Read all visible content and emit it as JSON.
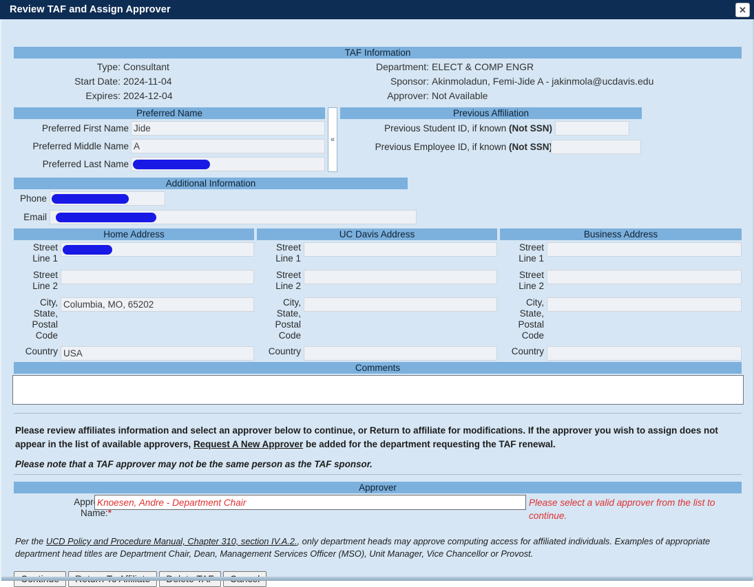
{
  "window": {
    "title": "Review TAF and Assign Approver",
    "close_label": "✕"
  },
  "taf_information": {
    "heading": "TAF Information",
    "rows": [
      {
        "label": "Type:",
        "value": "Consultant",
        "label2": "Department:",
        "value2": "ELECT & COMP ENGR"
      },
      {
        "label": "Start Date:",
        "value": "2024-11-04",
        "label2": "Sponsor:",
        "value2": "Akinmoladun, Femi-Jide A - jakinmola@ucdavis.edu"
      },
      {
        "label": "Expires:",
        "value": "2024-12-04",
        "label2": "Approver:",
        "value2": "Not Available"
      }
    ]
  },
  "preferred_name": {
    "heading": "Preferred Name",
    "fields": [
      {
        "label": "Preferred First Name",
        "value": "Jide",
        "redacted": false
      },
      {
        "label": "Preferred Middle Name",
        "value": "A",
        "redacted": false
      },
      {
        "label": "Preferred Last Name",
        "value": "",
        "redacted": true
      }
    ]
  },
  "splitter": {
    "glyph": "«"
  },
  "previous_affiliation": {
    "heading": "Previous Affiliation",
    "fields": [
      {
        "label": "Previous Student ID, if known ",
        "bold": "(Not SSN)",
        "value": ""
      },
      {
        "label": "Previous Employee ID, if known ",
        "bold": "(Not SSN)",
        "value": ""
      }
    ]
  },
  "additional_information": {
    "heading": "Additional Information",
    "fields": [
      {
        "label": "Phone",
        "value": "",
        "redacted": true
      },
      {
        "label": "Email",
        "value": "",
        "redacted": true
      }
    ]
  },
  "addresses": {
    "row_labels": [
      "Street Line 1",
      "Street Line 2",
      "City, State, Postal Code",
      "Country"
    ],
    "columns": [
      {
        "heading": "Home Address",
        "values": [
          "",
          "",
          "Columbia, MO, 65202",
          "USA"
        ],
        "redacted": [
          true,
          false,
          false,
          false
        ]
      },
      {
        "heading": "UC Davis Address",
        "values": [
          "",
          "",
          "",
          ""
        ],
        "redacted": [
          false,
          false,
          false,
          false
        ]
      },
      {
        "heading": "Business Address",
        "values": [
          "",
          "",
          "",
          ""
        ],
        "redacted": [
          false,
          false,
          false,
          false
        ]
      }
    ]
  },
  "comments": {
    "heading": "Comments",
    "value": "",
    "placeholder": ""
  },
  "instructions": {
    "paragraph_1_part_1": "Please review affiliates information and select an approver below to continue, or Return to affiliate for modifications. If the approver you wish to assign does not appear in the list of available approvers, ",
    "paragraph_1_link": "Request A New Approver",
    "paragraph_1_part_2": " be added for the department requesting the TAF renewal.",
    "paragraph_2": "Please note that a TAF approver may not be the same person as the TAF sponsor."
  },
  "approver": {
    "heading": "Approver",
    "label": "Approver Name:",
    "required_marker": "*",
    "value": "Knoesen, Andre - Department Chair",
    "error_message": "Please select a valid approver from the list to continue.",
    "error_color": "#e03030"
  },
  "policy_note": {
    "part_1": "Per the ",
    "link": "UCD Policy and Procedure Manual, Chapter 310, section IV.A.2.",
    "part_2": ", only department heads may approve computing access for affiliated individuals. Examples of appropriate department head titles are Department Chair, Dean, Management Services Officer (MSO), Unit Manager, Vice Chancellor or Provost."
  },
  "buttons": [
    {
      "label": "Continue"
    },
    {
      "label": "Return To Affiliate"
    },
    {
      "label": "Delete TAF"
    },
    {
      "label": "Cancel"
    }
  ],
  "theme": {
    "titlebar_bg": "#0e2d54",
    "section_header_bg": "#7cb0dd",
    "page_bg": "#d6e6f4",
    "field_bg": "#eef1f5",
    "redaction_color": "#1919e6"
  }
}
